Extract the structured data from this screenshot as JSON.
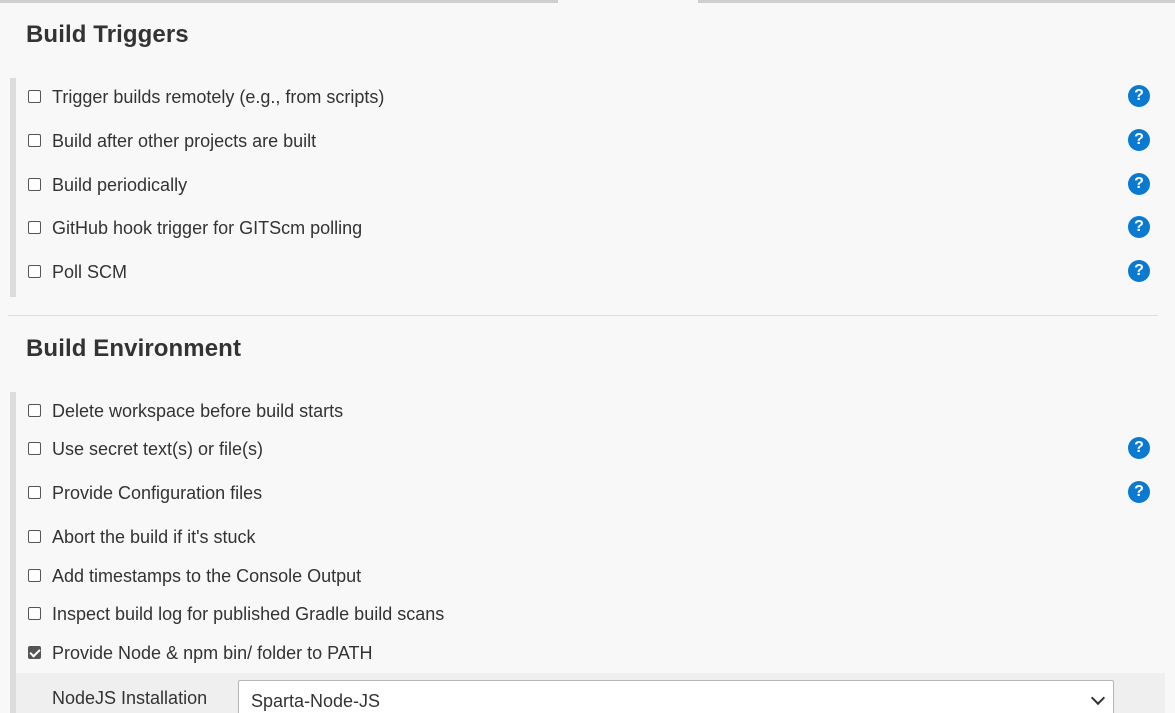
{
  "build_triggers": {
    "title": "Build Triggers",
    "options": [
      {
        "label": "Trigger builds remotely (e.g., from scripts)",
        "checked": false,
        "has_help": true
      },
      {
        "label": "Build after other projects are built",
        "checked": false,
        "has_help": true
      },
      {
        "label": "Build periodically",
        "checked": false,
        "has_help": true
      },
      {
        "label": "GitHub hook trigger for GITScm polling",
        "checked": false,
        "has_help": true
      },
      {
        "label": "Poll SCM",
        "checked": false,
        "has_help": true
      }
    ]
  },
  "build_environment": {
    "title": "Build Environment",
    "options": [
      {
        "label": "Delete workspace before build starts",
        "checked": false,
        "has_help": false
      },
      {
        "label": "Use secret text(s) or file(s)",
        "checked": false,
        "has_help": true
      },
      {
        "label": "Provide Configuration files",
        "checked": false,
        "has_help": true
      },
      {
        "label": "Abort the build if it's stuck",
        "checked": false,
        "has_help": false
      },
      {
        "label": "Add timestamps to the Console Output",
        "checked": false,
        "has_help": false
      },
      {
        "label": "Inspect build log for published Gradle build scans",
        "checked": false,
        "has_help": false
      },
      {
        "label": "Provide Node & npm bin/ folder to PATH",
        "checked": true,
        "has_help": false
      }
    ],
    "nodejs": {
      "label": "NodeJS Installation",
      "selected": "Sparta-Node-JS"
    }
  },
  "icons": {
    "help": "question-mark-icon",
    "dropdown": "chevron-down-icon",
    "help_glyph": "?"
  },
  "colors": {
    "help_icon": "#0a7ad1",
    "background": "#f8f8f8",
    "checked_box": "#555555"
  }
}
